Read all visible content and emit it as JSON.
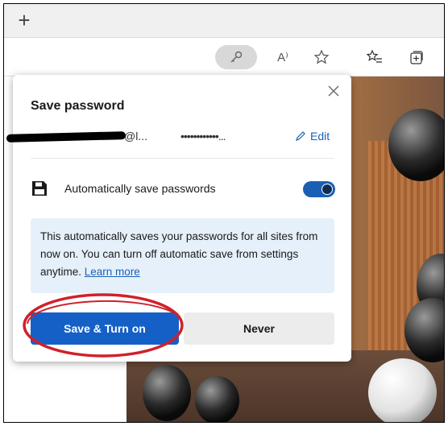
{
  "tabstrip": {
    "new_tab_symbol": "+"
  },
  "toolbar": {
    "icons": [
      "key-icon",
      "read-aloud-icon",
      "favorite-star-icon",
      "favorites-list-icon",
      "collections-icon"
    ],
    "read_aloud_text": "A⁾"
  },
  "dialog": {
    "title": "Save password",
    "username_visible": "@l...",
    "password_mask": "••••••••••••...",
    "edit_label": "Edit",
    "auto_save_label": "Automatically save passwords",
    "auto_save_enabled": true,
    "info_text": "This automatically saves your passwords for all sites from now on. You can turn off automatic save from settings anytime.",
    "learn_more": "Learn more",
    "primary_button": "Save & Turn on",
    "secondary_button": "Never"
  },
  "colors": {
    "accent": "#1560c7",
    "link": "#1a62b8",
    "info_bg": "#e6f0fa",
    "annotation": "#d0202a"
  }
}
